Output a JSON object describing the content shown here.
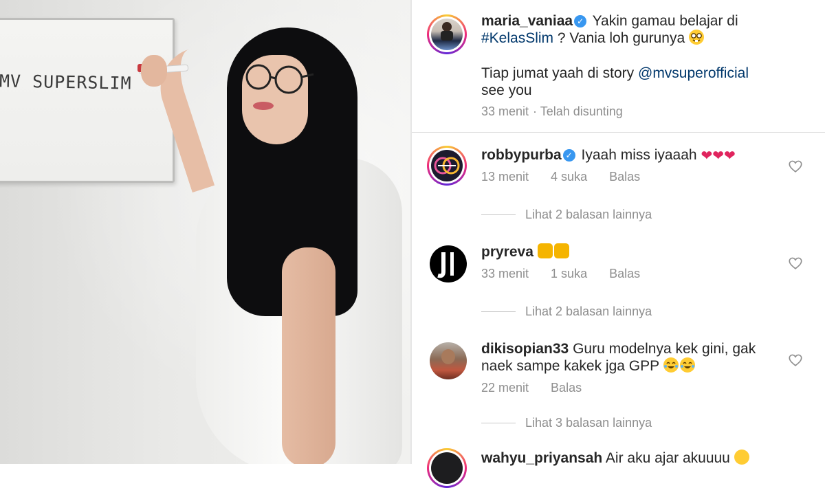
{
  "photo": {
    "board_text": "MV SUPERSLIM"
  },
  "post": {
    "username": "maria_vaniaa",
    "caption_part1": "Yakin gamau belajar di",
    "hashtag": "#KelasSlim",
    "caption_part2": "? Vania loh gurunya",
    "caption_line3": "Tiap jumat yaah di story",
    "mention": "@mvsuperofficial",
    "caption_line4": "see you",
    "time": "33 menit",
    "edited": "· Telah disunting"
  },
  "comments": [
    {
      "username": "robbypurba",
      "verified": true,
      "text": "Iyaah miss iyaaah",
      "time": "13 menit",
      "likes": "4 suka",
      "reply": "Balas",
      "replies_text": "Lihat 2 balasan lainnya"
    },
    {
      "username": "pryreva",
      "verified": false,
      "text": "",
      "time": "33 menit",
      "likes": "1 suka",
      "reply": "Balas",
      "replies_text": "Lihat 2 balasan lainnya"
    },
    {
      "username": "dikisopian33",
      "verified": false,
      "text_line1": "Guru modelnya kek gini, gak",
      "text_line2": "naek sampe kakek jga GPP",
      "time": "22 menit",
      "reply": "Balas",
      "replies_text": "Lihat 3 balasan lainnya"
    },
    {
      "username": "wahyu_priyansah",
      "text": "Air aku ajar akuuuu"
    }
  ],
  "colors": {
    "link": "#00376b",
    "verified": "#3897f0",
    "muted": "#8e8e8e",
    "heart_emoji": "#e0245e"
  },
  "icons": {
    "verified": "verified-badge-icon",
    "like": "heart-outline-icon"
  }
}
